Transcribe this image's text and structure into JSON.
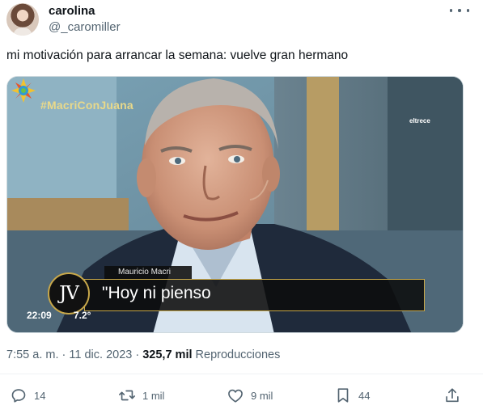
{
  "author": {
    "display_name": "carolina",
    "handle": "@_caromiller",
    "avatar_icon": "profile-photo"
  },
  "tweet": {
    "text": "mi motivación para arrancar la semana: vuelve gran hermano"
  },
  "media": {
    "hashtag": "#MacriConJuana",
    "channel_name": "eltrece",
    "caption_name": "Mauricio Macri",
    "caption_quote": "\"Hoy ni pienso",
    "show_logo": "JV",
    "clock": "22:09",
    "temperature": "7.2°"
  },
  "meta": {
    "time": "7:55 a. m.",
    "separator": "·",
    "date": "11 dic. 2023",
    "views_count": "325,7 mil",
    "views_label": "Reproducciones"
  },
  "actions": {
    "reply": {
      "icon": "reply-icon",
      "count": "14"
    },
    "retweet": {
      "icon": "retweet-icon",
      "count": "1 mil"
    },
    "like": {
      "icon": "heart-icon",
      "count": "9 mil"
    },
    "bookmark": {
      "icon": "bookmark-icon",
      "count": "44"
    },
    "share": {
      "icon": "share-icon"
    }
  },
  "colors": {
    "text_primary": "#0f1419",
    "text_secondary": "#536471",
    "caption_border": "#c8a84a"
  }
}
